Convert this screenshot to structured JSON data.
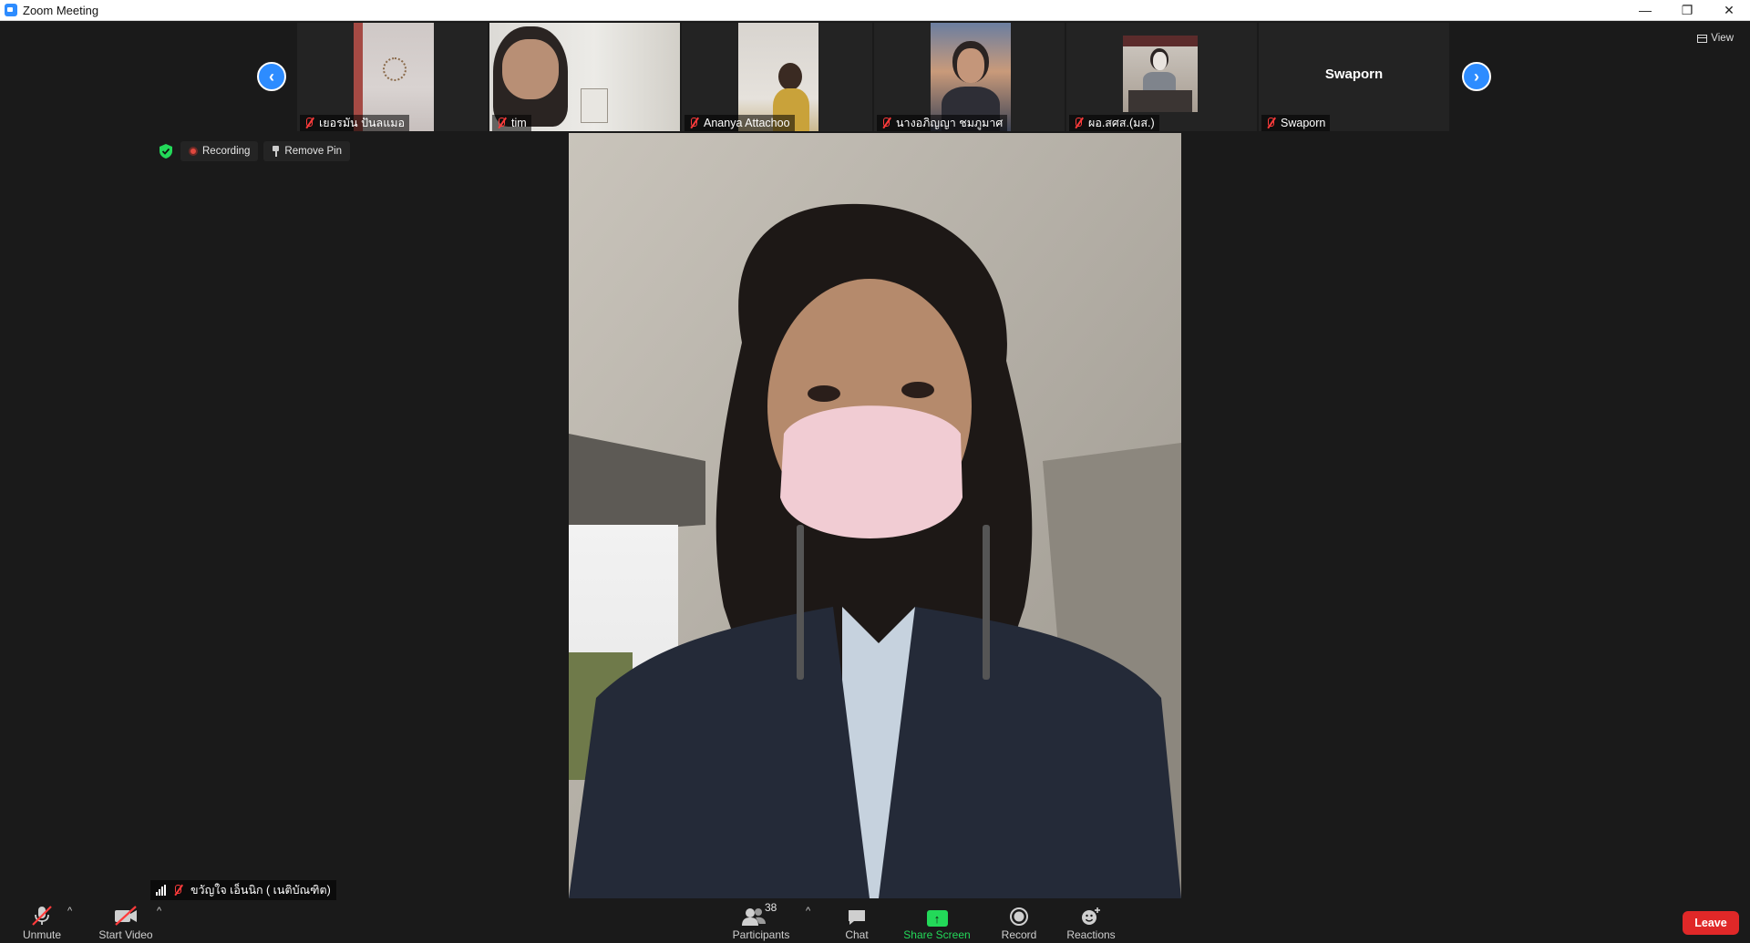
{
  "window": {
    "title": "Zoom Meeting",
    "minimize": "—",
    "restore": "❐",
    "close": "✕"
  },
  "view": {
    "label": "View"
  },
  "filmstrip": {
    "prev_icon": "chevron-left-icon",
    "next_icon": "chevron-right-icon",
    "tiles": [
      {
        "name": "เยอรมัน ปันลแมอ",
        "muted": true
      },
      {
        "name": "tim",
        "muted": true
      },
      {
        "name": "Ananya Attachoo",
        "muted": true
      },
      {
        "name": "นางอภิญญา ชมภูมาศ",
        "muted": true
      },
      {
        "name": "ผอ.สศส.(มส.)",
        "muted": true
      },
      {
        "name": "Swaporn",
        "muted": true,
        "display_name": "Swaporn",
        "video_off": true
      }
    ]
  },
  "status": {
    "recording": "Recording",
    "remove_pin": "Remove Pin"
  },
  "active_speaker": {
    "name": "ขวัญใจ เอ็นนิก ( เนติบัณฑิต)",
    "muted": true
  },
  "toolbar": {
    "unmute": "Unmute",
    "start_video": "Start Video",
    "participants": "Participants",
    "participants_count": "38",
    "chat": "Chat",
    "share_screen": "Share Screen",
    "record": "Record",
    "reactions": "Reactions",
    "leave": "Leave",
    "caret": "^"
  },
  "colors": {
    "accent": "#2d8cff",
    "leave": "#e02828",
    "share": "#23d959",
    "muted": "#ff3b3b"
  }
}
